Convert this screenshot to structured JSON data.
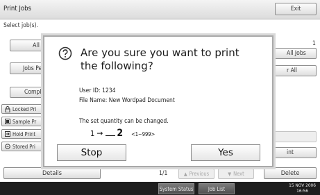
{
  "header": {
    "title": "Print Jobs",
    "exit_label": "Exit"
  },
  "left": {
    "select_jobs_label": "Select job(s).",
    "all_label": "All",
    "jobs_per_label": "Jobs Pe",
    "complete_label": "Compl",
    "job_types": [
      {
        "label": "Locked Pri",
        "icon": "lock-icon"
      },
      {
        "label": "Sample Pr",
        "icon": "sample-print-icon"
      },
      {
        "label": "Hold Print",
        "icon": "hold-print-icon"
      },
      {
        "label": "Stored Pri",
        "icon": "stored-print-icon"
      }
    ],
    "details_label": "Details"
  },
  "right": {
    "count_text": "1",
    "all_jobs_label": "All Jobs",
    "clear_all_label": "r All",
    "faded_label": "",
    "print_label": "int",
    "delete_label": "Delete"
  },
  "pager": {
    "page_text": "1/1",
    "previous_label": "Previous",
    "next_label": "Next"
  },
  "dialog": {
    "icon": "question-icon",
    "message_line1": "Are you sure you want to print",
    "message_line2": "the following?",
    "user_id_text": "User ID: 1234",
    "file_name_text": "File Name: New Wordpad Document",
    "quantity_note": "The set quantity can be changed.",
    "quantity_from": "1",
    "quantity_to": "2",
    "quantity_range": "<1~999>",
    "stop_label": "Stop",
    "yes_label": "Yes"
  },
  "footer": {
    "system_status_label": "System Status",
    "job_list_label": "Job List",
    "date_text": "15 NOV  2006",
    "time_text": "16:56"
  }
}
